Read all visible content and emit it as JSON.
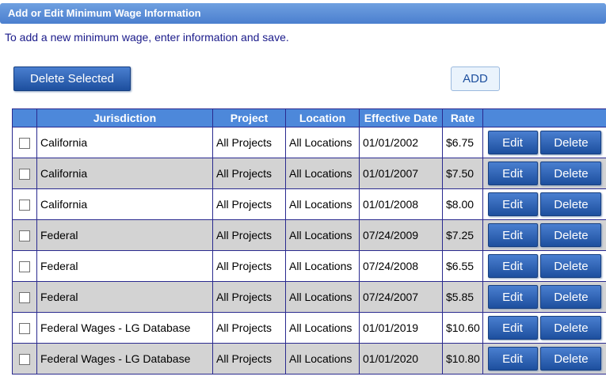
{
  "header": {
    "title": "Add or Edit Minimum Wage Information",
    "instructions": "To add a new minimum wage, enter information and save."
  },
  "toolbar": {
    "delete_selected_label": "Delete Selected",
    "add_label": "ADD"
  },
  "table": {
    "columns": [
      "",
      "Jurisdiction",
      "Project",
      "Location",
      "Effective Date",
      "Rate",
      ""
    ],
    "edit_label": "Edit",
    "delete_label": "Delete",
    "rows": [
      {
        "jurisdiction": "California",
        "project": "All Projects",
        "location": "All Locations",
        "effective_date": "01/01/2002",
        "rate": "$6.75"
      },
      {
        "jurisdiction": "California",
        "project": "All Projects",
        "location": "All Locations",
        "effective_date": "01/01/2007",
        "rate": "$7.50"
      },
      {
        "jurisdiction": "California",
        "project": "All Projects",
        "location": "All Locations",
        "effective_date": "01/01/2008",
        "rate": "$8.00"
      },
      {
        "jurisdiction": "Federal",
        "project": "All Projects",
        "location": "All Locations",
        "effective_date": "07/24/2009",
        "rate": "$7.25"
      },
      {
        "jurisdiction": "Federal",
        "project": "All Projects",
        "location": "All Locations",
        "effective_date": "07/24/2008",
        "rate": "$6.55"
      },
      {
        "jurisdiction": "Federal",
        "project": "All Projects",
        "location": "All Locations",
        "effective_date": "07/24/2007",
        "rate": "$5.85"
      },
      {
        "jurisdiction": "Federal Wages - LG Database",
        "project": "All Projects",
        "location": "All Locations",
        "effective_date": "01/01/2019",
        "rate": "$10.60"
      },
      {
        "jurisdiction": "Federal Wages - LG Database",
        "project": "All Projects",
        "location": "All Locations",
        "effective_date": "01/01/2020",
        "rate": "$10.80"
      }
    ]
  },
  "colors": {
    "header_blue": "#4d88da",
    "button_blue": "#1d4f9e",
    "alt_row": "#d3d3d3",
    "border": "#2a2a8f"
  }
}
